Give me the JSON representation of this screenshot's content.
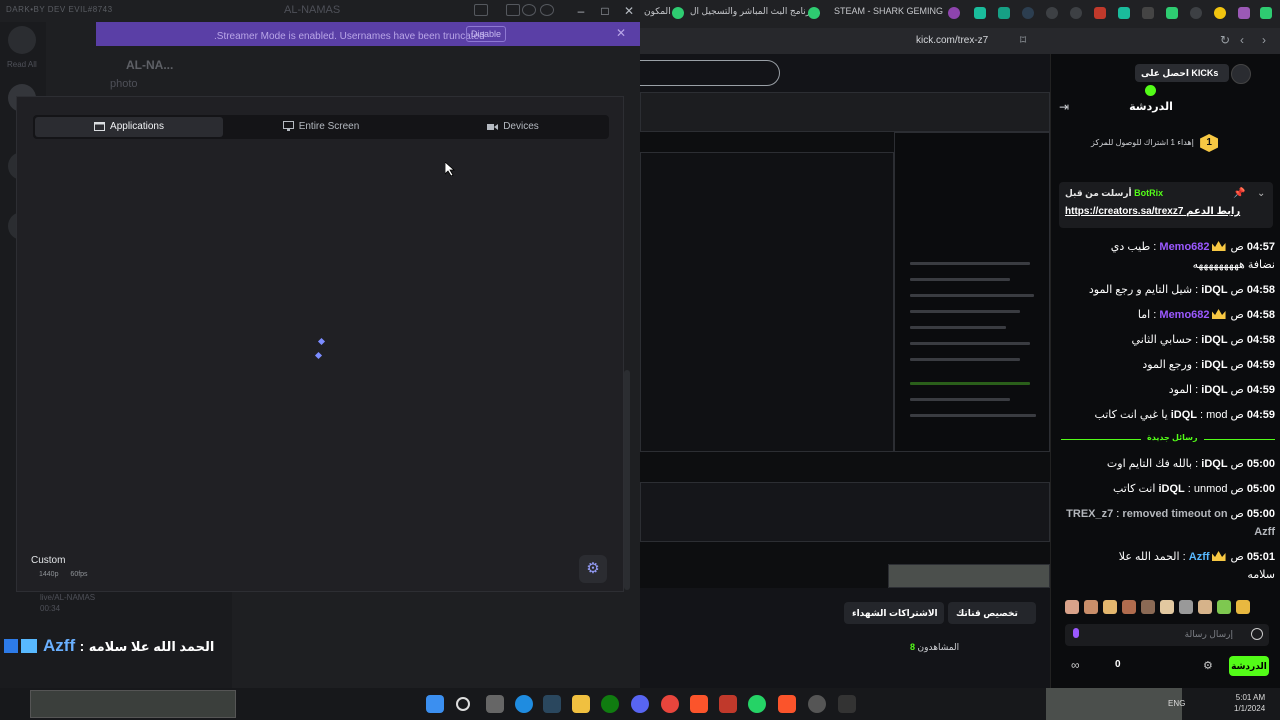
{
  "discord": {
    "titlebar_brand": "DARK•BY DEV EVIL#8743",
    "titlebar_center": "AL-NAMAS",
    "server_name": "AL-NA...",
    "channel_name": "photo",
    "home_label": "Read All",
    "banner": {
      "message": "Streamer Mode is enabled. Usernames have been truncated.",
      "disable_label": "Disable"
    },
    "screen_share": {
      "tabs": [
        {
          "label": "Applications",
          "icon": "window-icon",
          "active": true
        },
        {
          "label": "Entire Screen",
          "icon": "monitor-icon",
          "active": false
        },
        {
          "label": "Devices",
          "icon": "camera-icon",
          "active": false
        }
      ],
      "quality_label": "Custom",
      "resolution": "1440p",
      "fps": "60fps"
    },
    "voice_panel": {
      "live_line1": "live/AL-NAMAS",
      "live_line2": "00:34"
    },
    "overlay_message": {
      "username": "Azff",
      "separator": ":",
      "text": "الحمد الله علا سلامه"
    }
  },
  "browser": {
    "tabs": [
      {
        "label": "المكون"
      },
      {
        "label": "برنامج البث المباشر والتسجيل ال..."
      },
      {
        "label": "STEAM - SHARK GEMING"
      }
    ],
    "url": "kick.com/trex-z7"
  },
  "chat": {
    "get_kicks_label": "احصل على KICKs",
    "title": "الدردشة",
    "sub_goal_text": "إهداء 1 اشتراك للوصول للمركز",
    "sub_goal_rank": "1",
    "pinned": {
      "by_label": "أرسلت من قبل",
      "by_user": "BotRix",
      "link_label": "رابط الدعم",
      "link_url": "https://creators.sa/trexz7"
    },
    "messages": [
      {
        "time": "04:57",
        "ampm": "ص",
        "user": "Memo682",
        "color": "#9b59ff",
        "badge": "crown",
        "text": "طيب دي",
        "extra": "نضافة هههههههههه"
      },
      {
        "time": "04:58",
        "ampm": "ص",
        "user": "iDQL",
        "color": "#ffffff",
        "badge": "",
        "text": "شيل التايم و رجع المود"
      },
      {
        "time": "04:58",
        "ampm": "ص",
        "user": "Memo682",
        "color": "#9b59ff",
        "badge": "crown",
        "text": "اما"
      },
      {
        "time": "04:58",
        "ampm": "ص",
        "user": "iDQL",
        "color": "#ffffff",
        "badge": "",
        "text": "حسابي الثاني"
      },
      {
        "time": "04:59",
        "ampm": "ص",
        "user": "iDQL",
        "color": "#ffffff",
        "badge": "",
        "text": "ورجع المود"
      },
      {
        "time": "04:59",
        "ampm": "ص",
        "user": "iDQL",
        "color": "#ffffff",
        "badge": "",
        "text": "المود"
      },
      {
        "time": "04:59",
        "ampm": "ص",
        "user": "iDQL",
        "color": "#ffffff",
        "badge": "",
        "text": "mod يا غبي انت كاتب"
      }
    ],
    "new_messages_label": "رسائل جديدة",
    "messages_after": [
      {
        "time": "05:00",
        "ampm": "ص",
        "user": "iDQL",
        "color": "#ffffff",
        "badge": "",
        "text": "بالله فك التايم اوت"
      },
      {
        "time": "05:00",
        "ampm": "ص",
        "user": "iDQL",
        "color": "#ffffff",
        "badge": "",
        "text": "unmod انت كاتب"
      },
      {
        "time": "05:00",
        "ampm": "ص",
        "user": "TREX_z7",
        "color": "#b4b7bc",
        "badge": "",
        "text": "removed timeout on Azff",
        "system": true
      },
      {
        "time": "05:01",
        "ampm": "ص",
        "user": "Azff",
        "color": "#58b9ff",
        "badge": "crown",
        "text": "الحمد الله علا",
        "extra": "سلامه"
      }
    ],
    "input_placeholder": "إرسال رسالة",
    "viewer_count": "0",
    "chat_button": "الدردشة"
  },
  "stream": {
    "customize_label": "تخصيص قناتك",
    "subscriptions_label": "الاشتراكات الشهداء",
    "viewers_label": "المشاهدون",
    "viewers_count": "8"
  },
  "taskbar": {
    "lang": "ENG",
    "time": "5:01 AM",
    "date": "1/1/2024"
  }
}
